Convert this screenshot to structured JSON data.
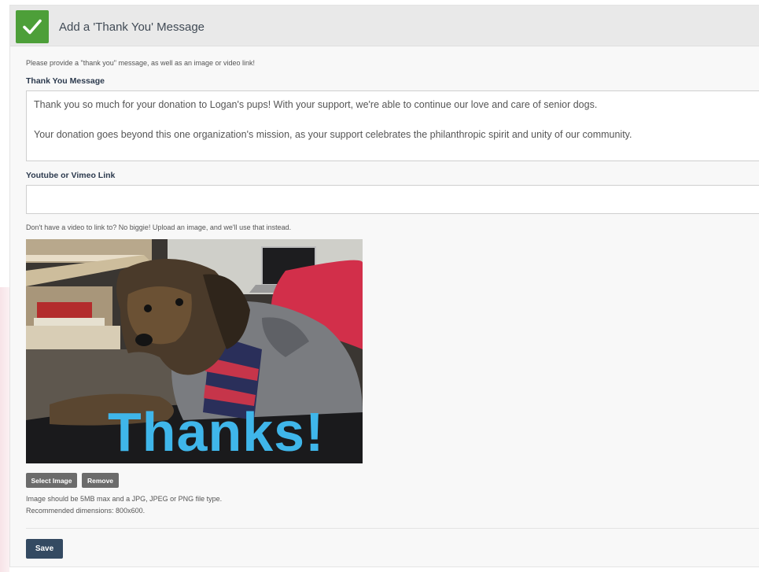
{
  "header": {
    "title": "Add a 'Thank You' Message",
    "status_color": "#4d9f39"
  },
  "intro": "Please provide a \"thank you\" message, as well as an image or video link!",
  "message": {
    "label": "Thank You Message",
    "paragraph_1": "Thank you so much for your donation to Logan's pups! With your support, we're able to continue our love and care of senior dogs.",
    "paragraph_2": "Your donation goes beyond this one organization's mission, as your support celebrates the philanthropic spirit and unity of our community."
  },
  "video": {
    "label": "Youtube or Vimeo Link",
    "value": "",
    "placeholder": ""
  },
  "image": {
    "hint": "Don't have a video to link to? No biggie! Upload an image, and we'll use that instead.",
    "caption": "Thanks!",
    "select_label": "Select Image",
    "remove_label": "Remove",
    "note_line_1": "Image should be 5MB max and a JPG, JPEG or PNG file type.",
    "note_line_2": "Recommended dimensions: 800x600."
  },
  "actions": {
    "save_label": "Save",
    "save_color": "#344a62"
  }
}
